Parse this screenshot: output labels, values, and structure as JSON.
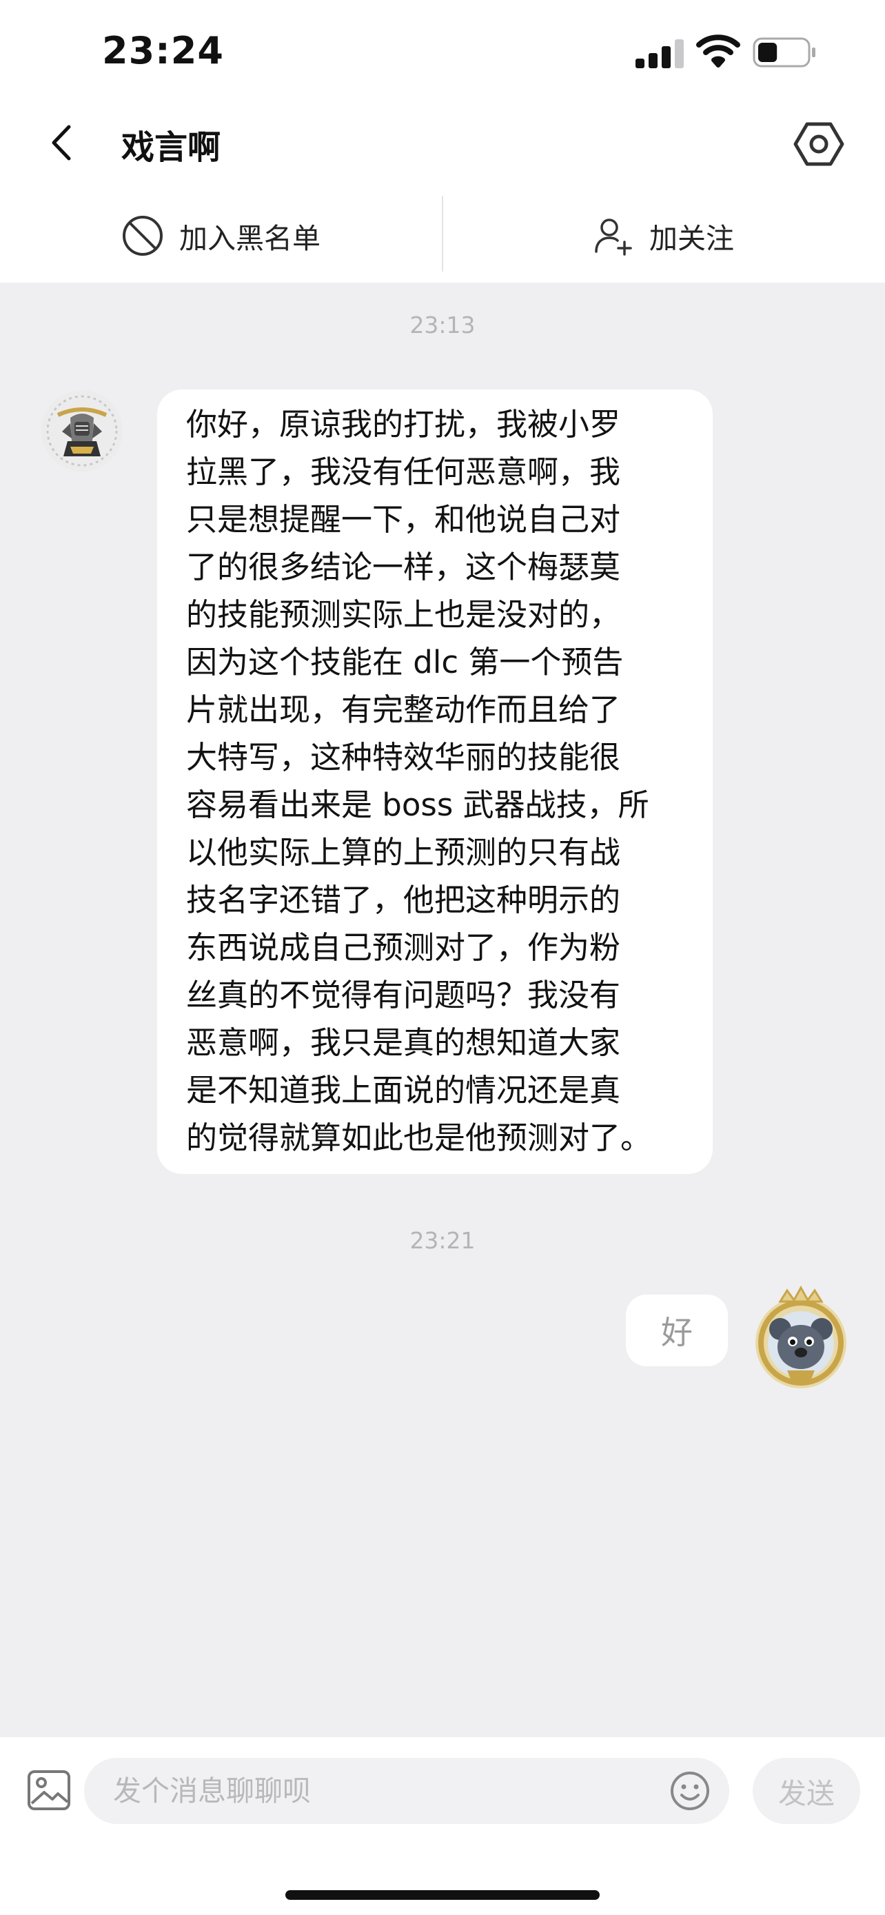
{
  "status_bar": {
    "time": "23:24",
    "battery_percent": 40
  },
  "header": {
    "title": "戏言啊"
  },
  "actions": {
    "block_label": "加入黑名单",
    "follow_label": "加关注"
  },
  "messages": [
    {
      "timestamp": "23:13",
      "direction": "incoming",
      "lines": [
        "你好，原谅我的打扰，我被小罗",
        "拉黑了，我没有任何恶意啊，我",
        "只是想提醒一下，和他说自己对",
        "了的很多结论一样，这个梅瑟莫",
        "的技能预测实际上也是没对的，",
        "因为这个技能在 dlc 第一个预告",
        "片就出现，有完整动作而且给了",
        "大特写，这种特效华丽的技能很",
        "容易看出来是 boss 武器战技，所",
        "以他实际上算的上预测的只有战",
        "技名字还错了，他把这种明示的",
        "东西说成自己预测对了，作为粉",
        "丝真的不觉得有问题吗？我没有",
        "恶意啊，我只是真的想知道大家",
        "是不知道我上面说的情况还是真",
        "的觉得就算如此也是他预测对了。"
      ]
    },
    {
      "timestamp": "23:21",
      "direction": "outgoing",
      "text": "好"
    }
  ],
  "composer": {
    "placeholder": "发个消息聊聊呗",
    "send_label": "发送"
  },
  "colors": {
    "background": "#efeff1",
    "bubble": "#ffffff",
    "text": "#121212",
    "muted": "#b4b4b8"
  }
}
